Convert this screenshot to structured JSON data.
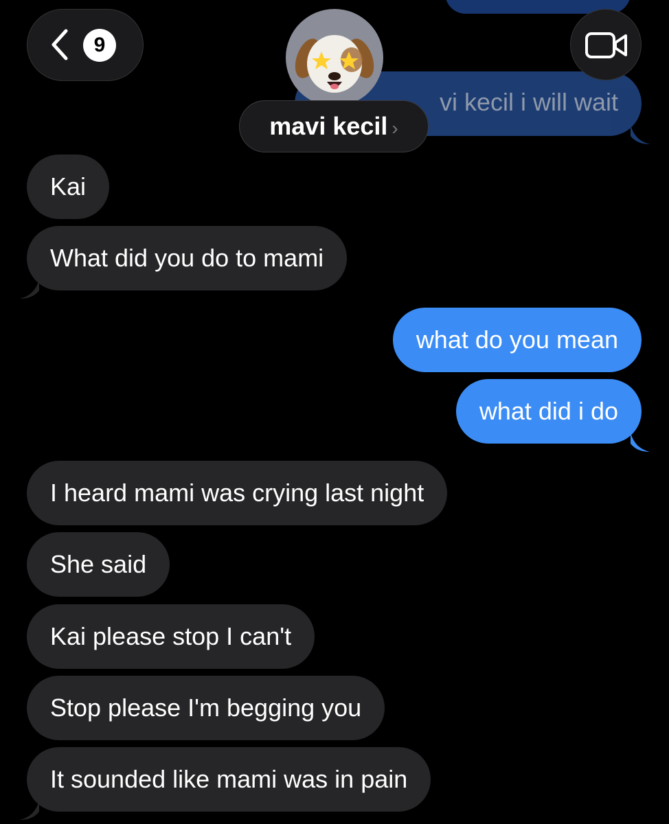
{
  "header": {
    "back_count": "9",
    "contact_name": "mavi kecil",
    "chevron": "›",
    "back_icon": "chevron-left-icon",
    "video_icon": "video-camera-icon"
  },
  "ghost_message": {
    "text": "vi kecil i will wait"
  },
  "messages": [
    {
      "dir": "in",
      "text": "Kai"
    },
    {
      "dir": "in",
      "text": "What did you do to mami"
    },
    {
      "dir": "out",
      "text": "what do you mean"
    },
    {
      "dir": "out",
      "text": "what did i do"
    },
    {
      "dir": "in",
      "text": "I heard mami was crying last night"
    },
    {
      "dir": "in",
      "text": "She said"
    },
    {
      "dir": "in",
      "text": "Kai please stop I can't"
    },
    {
      "dir": "in",
      "text": "Stop please I'm begging you"
    },
    {
      "dir": "in",
      "text": "It sounded like mami was in pain"
    }
  ],
  "colors": {
    "incoming_bubble": "#262628",
    "outgoing_bubble": "#3b8cf5",
    "background": "#000000"
  }
}
